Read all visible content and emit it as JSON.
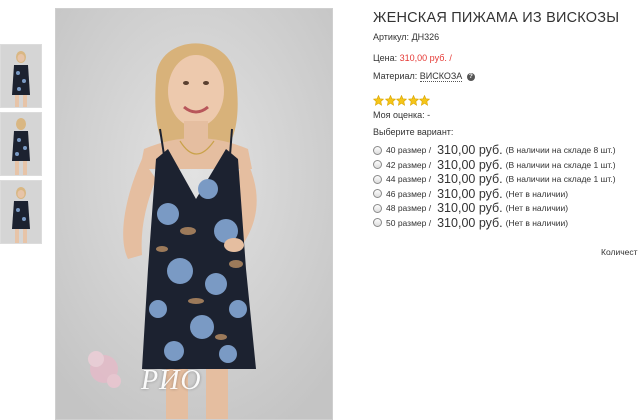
{
  "product": {
    "title": "ЖЕНСКАЯ ПИЖАМА ИЗ ВИСКОЗЫ",
    "sku_label": "Артикул:",
    "sku_value": "ДН326",
    "price_label": "Цена:",
    "price_value": "310,00 руб.",
    "price_sep": "/",
    "material_label": "Материал:",
    "material_value": "ВИСКОЗА",
    "rating_label": "Моя оценка: -",
    "stars_count": 5,
    "star_color": "#f5c518",
    "choose_label": "Выберите вариант:",
    "variants": [
      {
        "size": "40 размер /",
        "price": "310,00 руб.",
        "stock": "(В наличии на складе 8 шт.)"
      },
      {
        "size": "42 размер /",
        "price": "310,00 руб.",
        "stock": "(В наличии на складе 1 шт.)"
      },
      {
        "size": "44 размер /",
        "price": "310,00 руб.",
        "stock": "(В наличии на складе 1 шт.)"
      },
      {
        "size": "46 размер /",
        "price": "310,00 руб.",
        "stock": "(Нет в наличии)"
      },
      {
        "size": "48 размер /",
        "price": "310,00 руб.",
        "stock": "(Нет в наличии)"
      },
      {
        "size": "50 размер /",
        "price": "310,00 руб.",
        "stock": "(Нет в наличии)"
      }
    ],
    "qty_label": "Количест"
  },
  "gallery": {
    "watermark": "РИО",
    "thumb_count": 3
  },
  "colors": {
    "price_red": "#e53935",
    "dress_navy": "#1c2230",
    "flower_blue": "#7a9ac4"
  }
}
